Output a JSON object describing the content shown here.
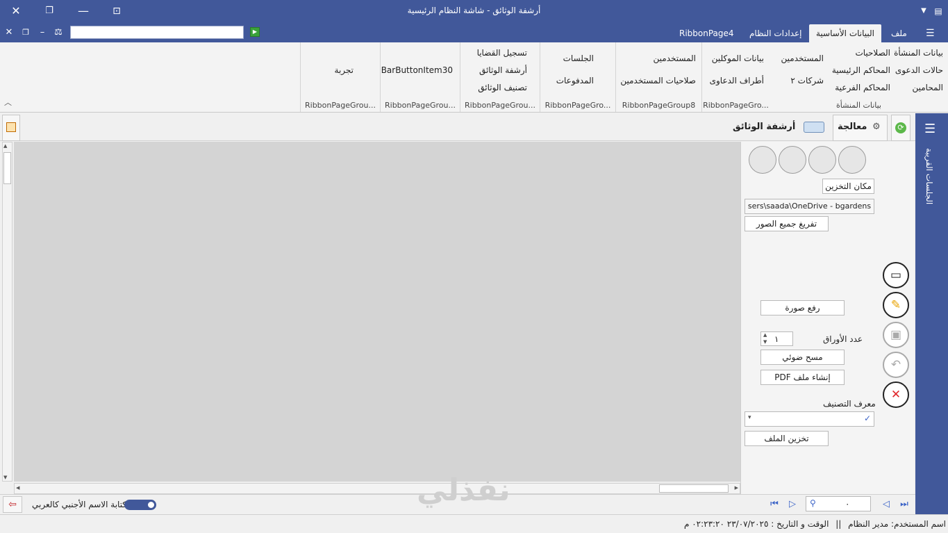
{
  "window": {
    "title": "أرشفة الوثائق - شاشة النظام الرئيسية"
  },
  "ribbon_tabs": [
    "ملف",
    "البيانات الأساسية",
    "إعدادات النظام",
    "RibbonPage4"
  ],
  "ribbon_groups": [
    {
      "label": "بيانات المنشأة",
      "items": [
        "بيانات المنشأة",
        "حالات الدعوى",
        "المحامين",
        "الصلاحيات",
        "المحاكم الرئيسية",
        "المحاكم الفرعية",
        "المستخدمين",
        "شركات ٢"
      ]
    },
    {
      "label": "RibbonPageGro...",
      "items": [
        "بيانات الموكلين",
        "أطراف الدعاوى"
      ]
    },
    {
      "label": "RibbonPageGroup8",
      "items": [
        "المستخدمين",
        "صلاحيات المستخدمين"
      ]
    },
    {
      "label": "RibbonPageGro...",
      "items": [
        "الجلسات",
        "المدفوعات"
      ]
    },
    {
      "label": "RibbonPageGrou...",
      "items": [
        "تسجيل القضايا",
        "أرشفة الوثائق",
        "تصنيف الوثائق"
      ]
    },
    {
      "label": "RibbonPageGrou...",
      "items": [
        "BarButtonItem30"
      ]
    },
    {
      "label": "RibbonPageGrou...",
      "items": [
        "تجربة"
      ]
    }
  ],
  "sidebar_label": "الجلسات القريبة",
  "doc_tabs": {
    "processing": "معالجة",
    "archive": "أرشفة الوثائق"
  },
  "panel": {
    "storage_label": "مكان التخزين",
    "storage_path": "sers\\saada\\OneDrive - bgardens",
    "clear_images": "تفريغ جميع الصور",
    "upload_image": "رفع صورة",
    "pages_label": "عدد الأوراق",
    "pages_value": "١",
    "scan": "مسح ضوئي",
    "make_pdf": "إنشاء ملف PDF",
    "class_label": "معرف التصنيف",
    "save_file": "تخزين الملف"
  },
  "bottom": {
    "toggle_label": "كتابة الاسم الأجنبي كالعربي",
    "page_value": "٠",
    "watermark": "نفذلي"
  },
  "status": {
    "user_label": "اسم المستخدم:",
    "user_value": "مدير النظام",
    "sep": "||",
    "datetime_label": "الوقت و التاريخ :",
    "datetime_value": "٢٣/٠٧/٢٠٢٥ ٠٢:٢٣:٢٠ م"
  },
  "colors": {
    "accent": "#41589a",
    "canvas": "#d4d4d4",
    "danger": "#e0262b"
  }
}
